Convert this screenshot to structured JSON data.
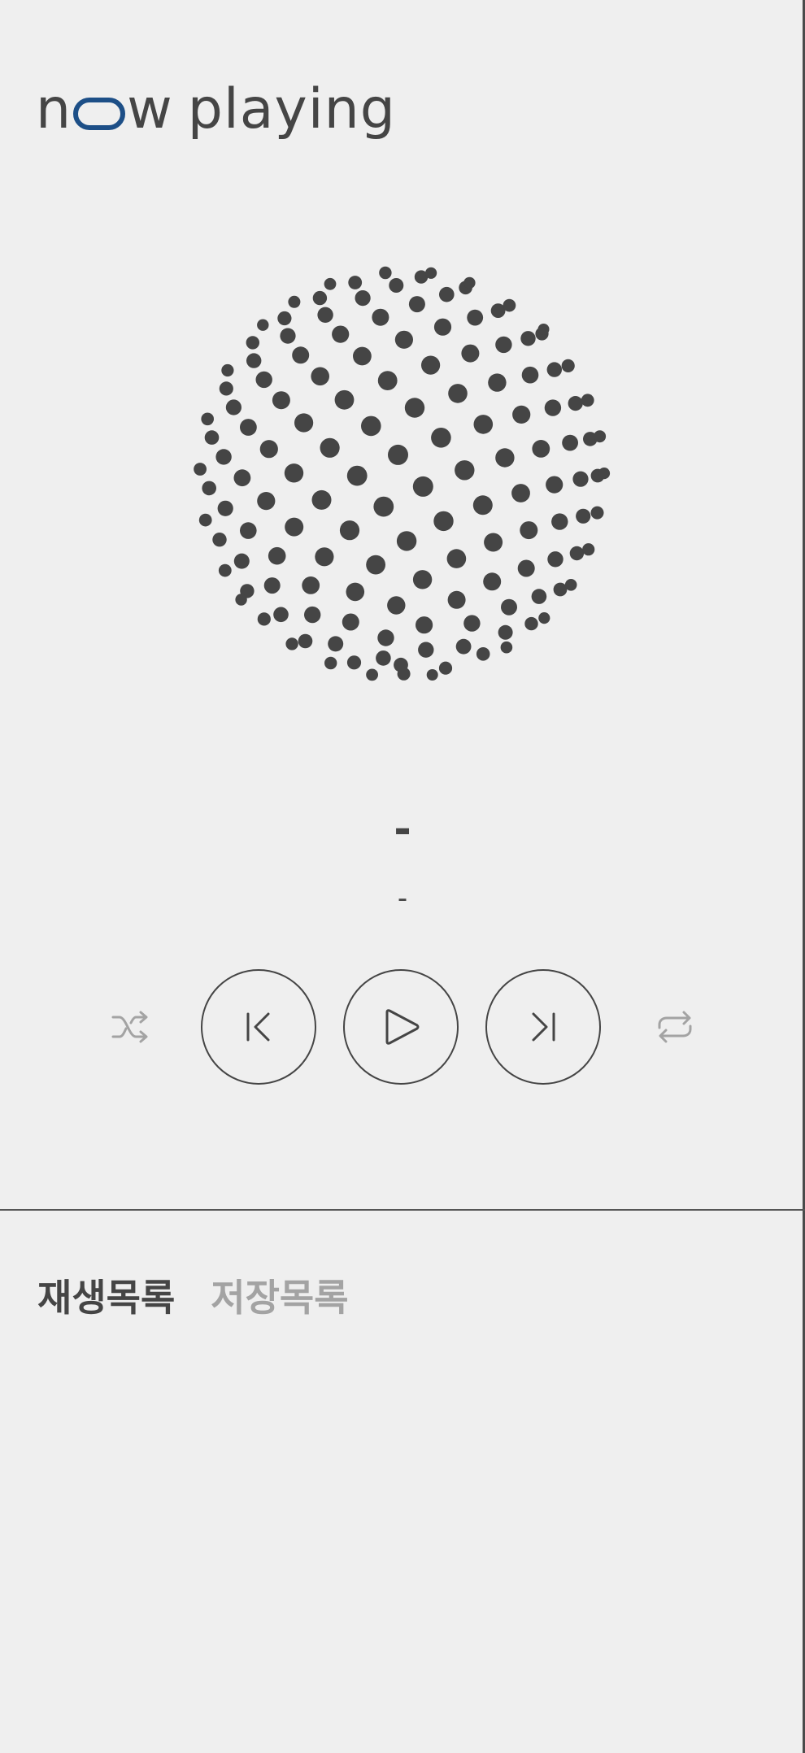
{
  "app": {
    "logo_part1": "n",
    "logo_part2": "w",
    "logo_part3": "playing",
    "logo_accent_color": "#1d4f87",
    "text_color": "#454545"
  },
  "now_playing": {
    "title": "-",
    "artist": "-"
  },
  "controls": {
    "shuffle_icon": "shuffle-icon",
    "previous_icon": "skip-previous-icon",
    "play_icon": "play-icon",
    "next_icon": "skip-next-icon",
    "repeat_icon": "repeat-icon",
    "disabled_color": "#a3a3a3"
  },
  "tabs": [
    {
      "label": "재생목록",
      "active": true
    },
    {
      "label": "저장목록",
      "active": false
    }
  ]
}
